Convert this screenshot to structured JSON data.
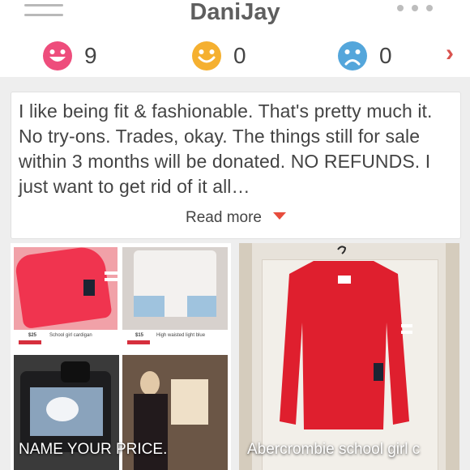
{
  "header": {
    "title": "DaniJay"
  },
  "ratings": [
    {
      "icon": "smiley-love-icon",
      "count": "9",
      "color": "#ee4d7c"
    },
    {
      "icon": "smiley-happy-icon",
      "count": "0",
      "color": "#f5b030"
    },
    {
      "icon": "smiley-sad-icon",
      "count": "0",
      "color": "#54a6db"
    }
  ],
  "about": {
    "text": "I like being fit & fashionable. That's pretty much it. No try-ons. Trades, okay. The things still for sale within 3 months will be donated. NO REFUNDS. I just want to get rid of it all…",
    "read_more": "Read more"
  },
  "listings": [
    {
      "title": "NAME YOUR PRICE.",
      "collage": [
        {
          "price": "$25",
          "caption": "School girl cardigan"
        },
        {
          "price": "$15",
          "caption": "High waisted light blue"
        }
      ]
    },
    {
      "title": "Abercrombie school girl c"
    }
  ]
}
